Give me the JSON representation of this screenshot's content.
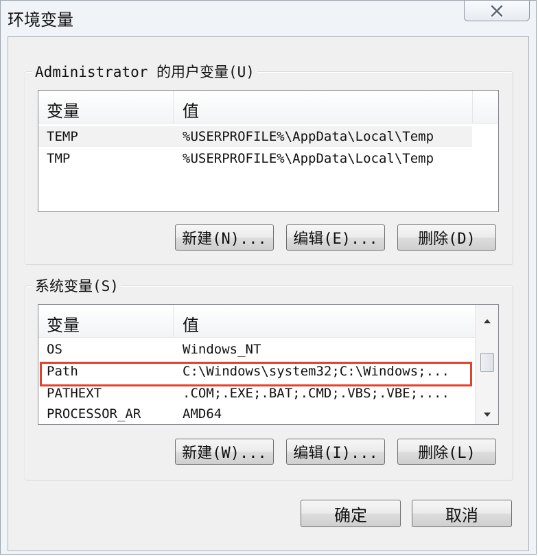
{
  "window": {
    "title": "环境变量",
    "close_icon": "close-icon"
  },
  "user_vars": {
    "group_label": "Administrator 的用户变量(U)",
    "columns": [
      "变量",
      "值"
    ],
    "rows": [
      {
        "name": "TEMP",
        "value": "%USERPROFILE%\\AppData\\Local\\Temp"
      },
      {
        "name": "TMP",
        "value": "%USERPROFILE%\\AppData\\Local\\Temp"
      }
    ],
    "buttons": {
      "new": "新建(N)...",
      "edit": "编辑(E)...",
      "delete": "删除(D)"
    }
  },
  "system_vars": {
    "group_label": "系统变量(S)",
    "columns": [
      "变量",
      "值"
    ],
    "rows": [
      {
        "name": "OS",
        "value": "Windows_NT"
      },
      {
        "name": "Path",
        "value": "C:\\Windows\\system32;C:\\Windows;..."
      },
      {
        "name": "PATHEXT",
        "value": ".COM;.EXE;.BAT;.CMD;.VBS;.VBE;...."
      },
      {
        "name": "PROCESSOR_AR",
        "value": "AMD64"
      }
    ],
    "highlighted_row": "Path",
    "highlight_color": "#e0422e",
    "buttons": {
      "new": "新建(W)...",
      "edit": "编辑(I)...",
      "delete": "删除(L)"
    }
  },
  "footer": {
    "ok": "确定",
    "cancel": "取消"
  }
}
